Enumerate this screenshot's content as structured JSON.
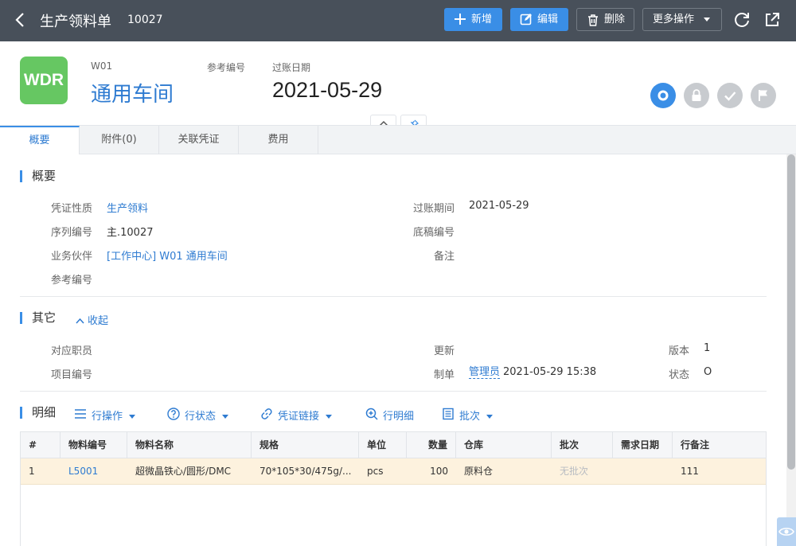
{
  "topbar": {
    "title": "生产领料单",
    "doc_no": "10027",
    "buttons": {
      "add": "新增",
      "edit": "编辑",
      "delete": "删除",
      "more": "更多操作"
    }
  },
  "header": {
    "logo": "WDR",
    "code": "W01",
    "name": "通用车间",
    "ref_label": "参考编号",
    "date_label": "过账日期",
    "date_value": "2021-05-29"
  },
  "tabs": [
    {
      "label": "概要"
    },
    {
      "label": "附件(0)"
    },
    {
      "label": "关联凭证"
    },
    {
      "label": "费用"
    }
  ],
  "summary": {
    "title": "概要",
    "fields": {
      "voucher_type": {
        "label": "凭证性质",
        "value": "生产领料"
      },
      "serial_no": {
        "label": "序列编号",
        "value": "主.10027"
      },
      "partner": {
        "label": "业务伙伴",
        "value": "[工作中心] W01 通用车间"
      },
      "ref_no": {
        "label": "参考编号",
        "value": ""
      },
      "period": {
        "label": "过账期间",
        "value": "2021-05-29"
      },
      "draft_no": {
        "label": "底稿编号",
        "value": ""
      },
      "remark": {
        "label": "备注",
        "value": ""
      }
    }
  },
  "other": {
    "title": "其它",
    "collapse_label": "收起",
    "fields": {
      "employee": {
        "label": "对应职员",
        "value": ""
      },
      "project": {
        "label": "项目编号",
        "value": ""
      },
      "updated": {
        "label": "更新",
        "value": ""
      },
      "maker": {
        "label": "制单",
        "user": "管理员",
        "time": "2021-05-29 15:38"
      },
      "version": {
        "label": "版本",
        "value": "1"
      },
      "status": {
        "label": "状态",
        "value": "O"
      }
    }
  },
  "detail": {
    "title": "明细",
    "actions": [
      "行操作",
      "行状态",
      "凭证链接",
      "行明细",
      "批次"
    ],
    "columns": [
      "#",
      "物料编号",
      "物料名称",
      "规格",
      "单位",
      "数量",
      "仓库",
      "批次",
      "需求日期",
      "行备注"
    ],
    "rows": [
      {
        "idx": "1",
        "code": "L5001",
        "name": "超微晶铁心/圆形/DMC",
        "spec": "70*105*30/475g/...",
        "unit": "pcs",
        "qty": "100",
        "warehouse": "原料仓",
        "batch": "无批次",
        "date": "",
        "note": "111"
      }
    ]
  },
  "colors": {
    "topbar": "#48505a",
    "accent": "#3a8ee6",
    "logo": "#66c762",
    "selected_row": "#fdf2de"
  }
}
